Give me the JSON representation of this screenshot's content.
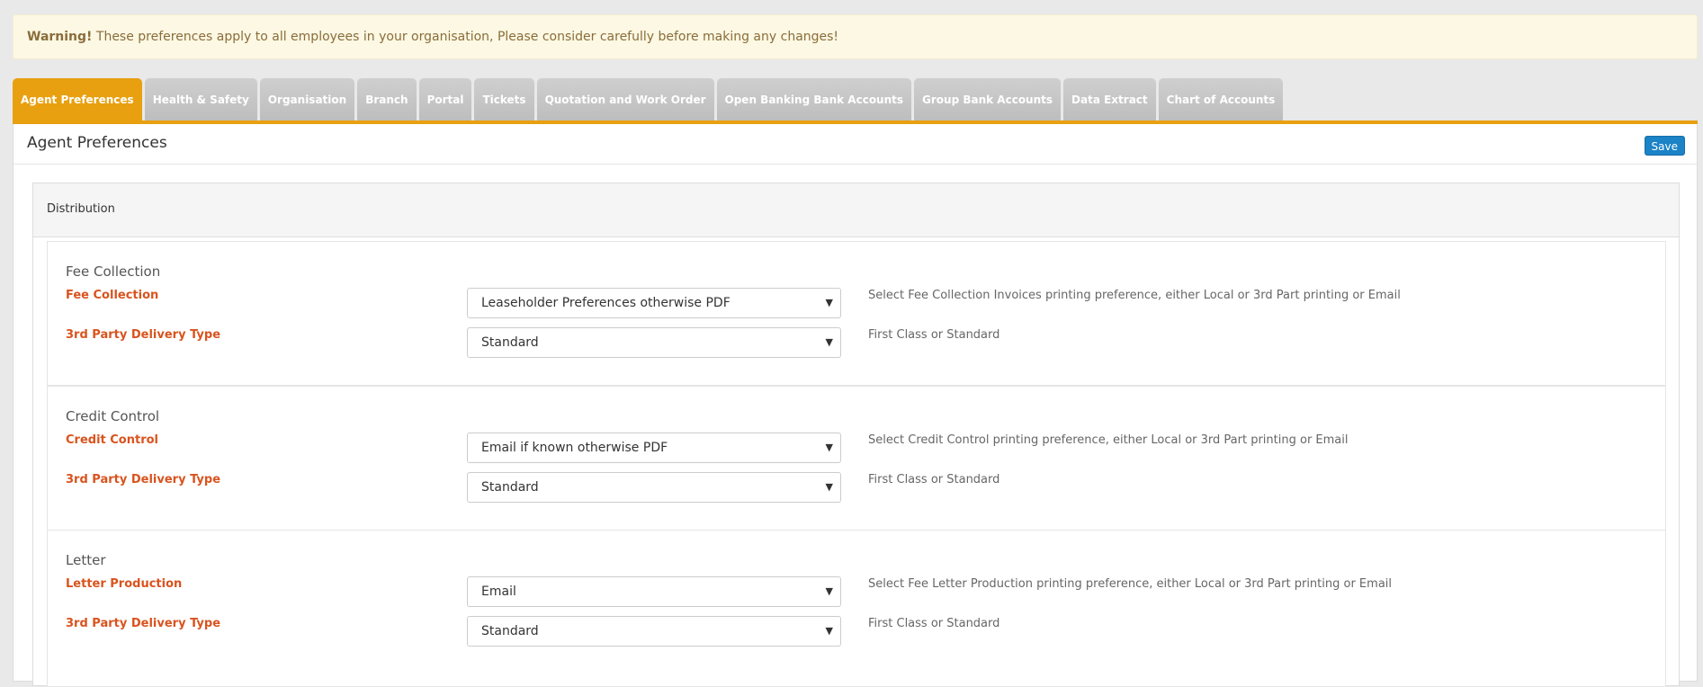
{
  "warning": {
    "strong": "Warning!",
    "text": " These preferences apply to all employees in your organisation, Please consider carefully before making any changes!"
  },
  "tabs": [
    {
      "label": "Agent Preferences",
      "active": true
    },
    {
      "label": "Health & Safety"
    },
    {
      "label": "Organisation"
    },
    {
      "label": "Branch"
    },
    {
      "label": "Portal"
    },
    {
      "label": "Tickets"
    },
    {
      "label": "Quotation and Work Order"
    },
    {
      "label": "Open Banking Bank Accounts"
    },
    {
      "label": "Group Bank Accounts"
    },
    {
      "label": "Data Extract"
    },
    {
      "label": "Chart of Accounts"
    }
  ],
  "panel": {
    "title": "Agent Preferences",
    "save_label": "Save",
    "distribution_label": "Distribution"
  },
  "sections": [
    {
      "title": "Fee Collection",
      "rows": [
        {
          "label": "Fee Collection",
          "value": "Leaseholder Preferences otherwise PDF",
          "help": "Select Fee Collection Invoices printing preference, either Local or 3rd Part printing or Email"
        },
        {
          "label": "3rd Party Delivery Type",
          "value": "Standard",
          "help": "First Class or Standard"
        }
      ]
    },
    {
      "title": "Credit Control",
      "rows": [
        {
          "label": "Credit Control",
          "value": "Email if known otherwise PDF",
          "help": "Select Credit Control printing preference, either Local or 3rd Part printing or Email"
        },
        {
          "label": "3rd Party Delivery Type",
          "value": "Standard",
          "help": "First Class or Standard"
        }
      ]
    },
    {
      "title": "Letter",
      "rows": [
        {
          "label": "Letter Production",
          "value": "Email",
          "help": "Select Fee Letter Production printing preference, either Local or 3rd Part printing or Email"
        },
        {
          "label": "3rd Party Delivery Type",
          "value": "Standard",
          "help": "First Class or Standard"
        }
      ]
    }
  ],
  "colors": {
    "accent": "#e8a010",
    "label": "#d9531e",
    "save": "#1b83c6",
    "warning_bg": "#fcf8e3"
  }
}
